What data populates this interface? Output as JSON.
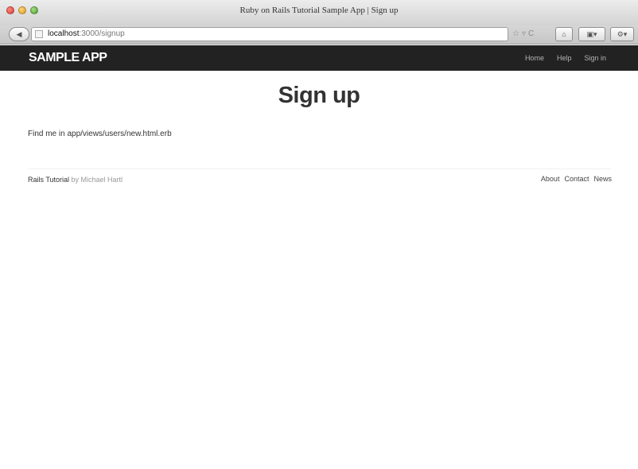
{
  "window": {
    "title": "Ruby on Rails Tutorial Sample App | Sign up"
  },
  "browser": {
    "url_host": "localhost",
    "url_path": ":3000/signup",
    "back_label": "◀",
    "star_glyph": "☆",
    "dropdown_glyph": "▿",
    "reload_glyph": "C",
    "home_glyph": "⌂",
    "bookmarks_glyph": "▣▾",
    "addons_glyph": "⚙▾"
  },
  "site": {
    "brand": "SAMPLE APP",
    "nav": [
      "Home",
      "Help",
      "Sign in"
    ]
  },
  "page": {
    "heading": "Sign up",
    "body_text": "Find me in app/views/users/new.html.erb"
  },
  "footer": {
    "left_link": "Rails Tutorial",
    "left_by": " by Michael Hartl",
    "nav": [
      "About",
      "Contact",
      "News"
    ]
  },
  "colors": {
    "navbar_bg": "#222222",
    "brand_text": "#ffffff",
    "nav_text": "#b5b5b5"
  }
}
